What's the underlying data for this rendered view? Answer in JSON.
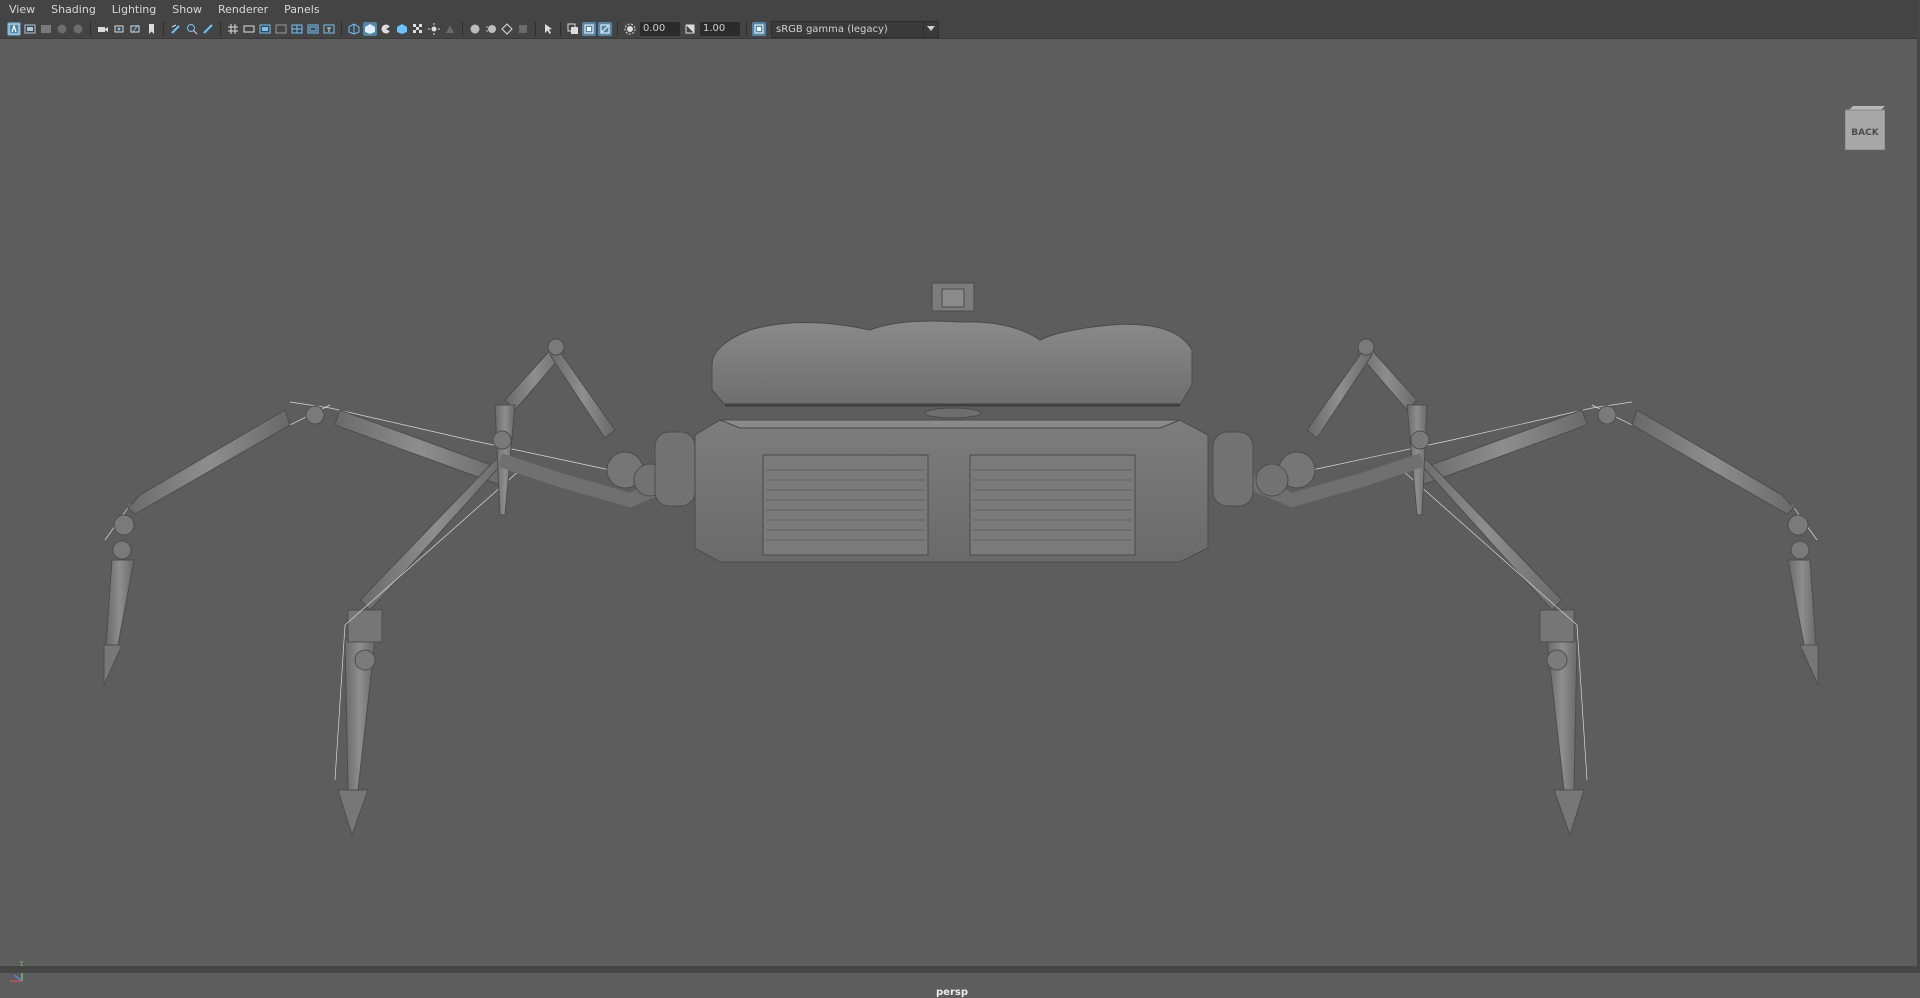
{
  "menu": {
    "items": [
      "View",
      "Shading",
      "Lighting",
      "Show",
      "Renderer",
      "Panels"
    ]
  },
  "toolbar": {
    "exposure_value": "0.00",
    "gamma_value": "1.00",
    "colorspace": "sRGB gamma (legacy)",
    "icons": [
      "select-camera-icon",
      "camera-attributes-icon",
      "bookmark-icon",
      "image-plane-icon",
      "grid-icon",
      "film-gate-icon",
      "resolution-gate-icon",
      "gate-mask-icon",
      "field-chart-icon",
      "safe-action-icon",
      "safe-title-icon",
      "wireframe-icon",
      "smooth-shade-icon",
      "use-default-material-icon",
      "textured-icon",
      "use-all-lights-icon",
      "shadows-icon",
      "screen-space-ao-icon",
      "motion-blur-icon",
      "anti-aliasing-icon",
      "isolate-select-icon",
      "xray-icon",
      "xray-joints-icon",
      "xray-active-components-icon",
      "exposure-icon",
      "gamma-icon",
      "color-management-icon"
    ]
  },
  "viewport": {
    "camera": "persp",
    "view_cube_face": "BACK",
    "background_color": "#5d5d5d"
  }
}
